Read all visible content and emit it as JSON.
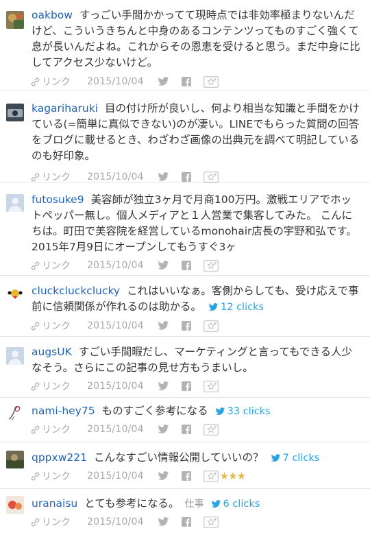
{
  "meta_labels": {
    "link": "リンク"
  },
  "colors": {
    "username": "#1f63b8",
    "clicks": "#2aa3e6",
    "meta": "#a8a8a8",
    "stars": "#e9b84a"
  },
  "comments": [
    {
      "user": "oakbow",
      "avatar": "photo-avatar",
      "text": "すっごい手間かかってて現時点では非効率極まりないんだけど、こういうきちんと中身のあるコンテンツってものすごく強くて息が長いんだよね。これからその恩恵を受けると思う。まだ中身に比してアクセス少ないけど。",
      "date": "2015/10/04"
    },
    {
      "user": "kagariharuki",
      "avatar": "photo-avatar",
      "text": "目の付け所が良いし、何より相当な知識と手間をかけている(=簡単に真似できない)のが凄い。LINEでもらった質問の回答をブログに載せるとき、わざわざ画像の出典元を調べて明記しているのも好印象。",
      "date": "2015/10/04"
    },
    {
      "user": "futosuke9",
      "avatar": "default-avatar",
      "text": "美容師が独立3ヶ月で月商100万円。激戦エリアでホットペッパー無し。個人メディアと１人営業で集客してみた。 こんにちは。町田で美容院を経営しているmonohair店長の宇野和弘です。 2015年7月9日にオープンしてもうすぐ3ヶ",
      "date": "2015/10/04"
    },
    {
      "user": "cluckcluckclucky",
      "avatar": "bird-avatar",
      "text": "これはいいなぁ。客側からしても、受け応えで事前に信頼関係が作れるのは助かる。",
      "clicks": "12 clicks",
      "date": "2015/10/04"
    },
    {
      "user": "augsUK",
      "avatar": "default-avatar",
      "text": "すごい手間暇だし、マーケティングと言ってもできる人少なそう。さらにこの記事の見せ方もうまいし。",
      "date": "2015/10/04"
    },
    {
      "user": "nami-hey75",
      "avatar": "sketch-avatar",
      "text": "ものすごく参考になる",
      "clicks": "33 clicks",
      "date": "2015/10/04"
    },
    {
      "user": "qppxw221",
      "avatar": "photo-avatar",
      "text": "こんなすごい情報公開していいの？",
      "clicks": "7 clicks",
      "stars": "★★★",
      "star_count": 3,
      "date": "2015/10/04"
    },
    {
      "user": "uranaisu",
      "avatar": "photo-avatar",
      "text": "とても参考になる。",
      "tag": "仕事",
      "clicks": "6 clicks",
      "date": "2015/10/04"
    }
  ]
}
